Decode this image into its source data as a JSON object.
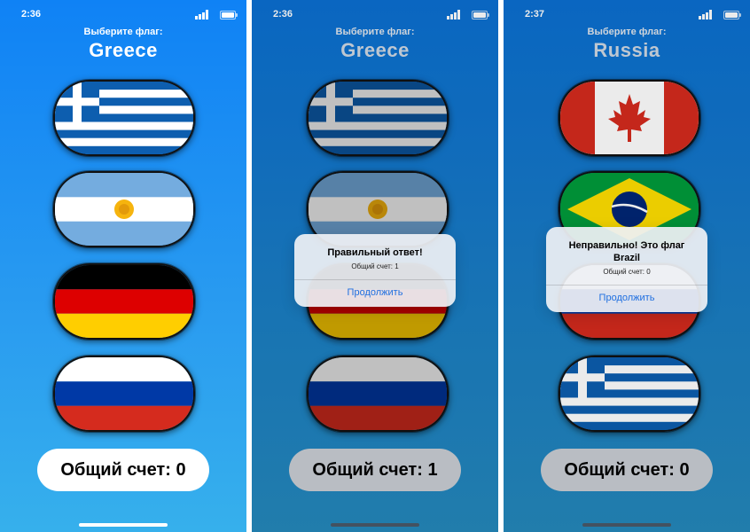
{
  "phones": [
    {
      "status_time": "2:36",
      "prompt": "Выберите флаг:",
      "country": "Greece",
      "score": "Общий счет: 0",
      "flags": [
        "Greece",
        "Argentina",
        "Germany",
        "Russia"
      ]
    },
    {
      "status_time": "2:36",
      "prompt": "Выберите флаг:",
      "country": "Greece",
      "score": "Общий счет: 1",
      "flags": [
        "Greece",
        "Argentina",
        "Germany",
        "Russia"
      ],
      "alert": {
        "title": "Правильный ответ!",
        "message": "Общий счет: 1",
        "button": "Продолжить"
      }
    },
    {
      "status_time": "2:37",
      "prompt": "Выберите флаг:",
      "country": "Russia",
      "score": "Общий счет: 0",
      "flags": [
        "Canada",
        "Brazil",
        "Russia",
        "Greece"
      ],
      "alert": {
        "title": "Неправильно! Это флаг Brazil",
        "message": "Общий счет: 0",
        "button": "Продолжить"
      }
    }
  ],
  "colors": {
    "accent": "#1f6fe0",
    "gradient_top": "#0f82f5",
    "gradient_bottom": "#36b0ec"
  }
}
